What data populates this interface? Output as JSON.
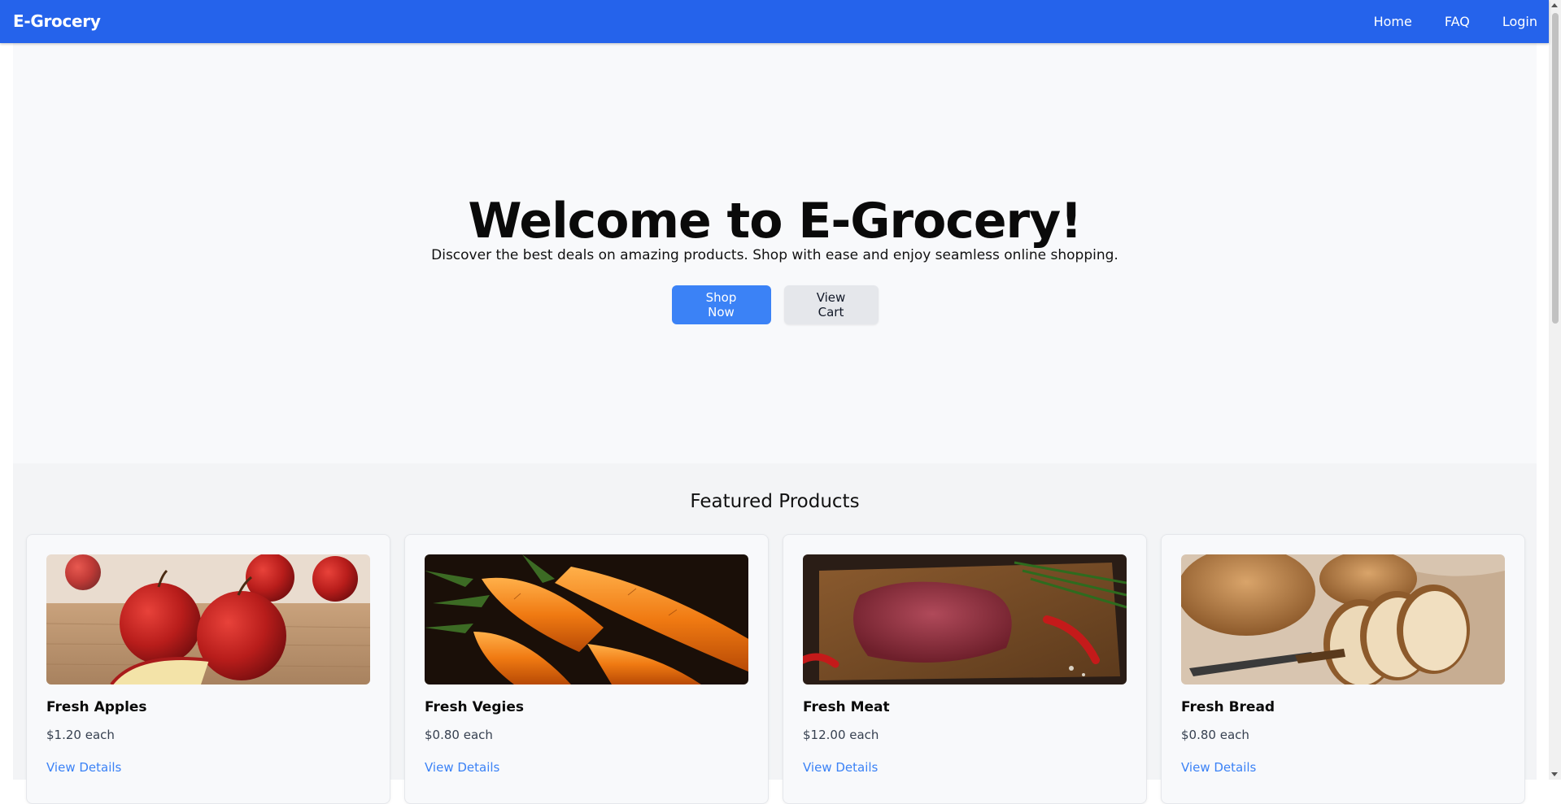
{
  "navbar": {
    "brand": "E-Grocery",
    "links": [
      "Home",
      "FAQ",
      "Login"
    ]
  },
  "hero": {
    "title": "Welcome to E-Grocery!",
    "subtitle": "Discover the best deals on amazing products. Shop with ease and enjoy seamless online shopping.",
    "primary_button": "Shop Now",
    "secondary_button": "View Cart"
  },
  "featured": {
    "title": "Featured Products",
    "products": [
      {
        "name": "Fresh Apples",
        "price": "$1.20 each",
        "link": "View Details",
        "image": "apples-image"
      },
      {
        "name": "Fresh Vegies",
        "price": "$0.80 each",
        "link": "View Details",
        "image": "carrots-image"
      },
      {
        "name": "Fresh Meat",
        "price": "$12.00 each",
        "link": "View Details",
        "image": "meat-image"
      },
      {
        "name": "Fresh Bread",
        "price": "$0.80 each",
        "link": "View Details",
        "image": "bread-image"
      }
    ]
  },
  "colors": {
    "navbar": "#2563eb",
    "primary_button": "#3b82f6",
    "secondary_button": "#e5e7eb",
    "link": "#3b82f6"
  }
}
